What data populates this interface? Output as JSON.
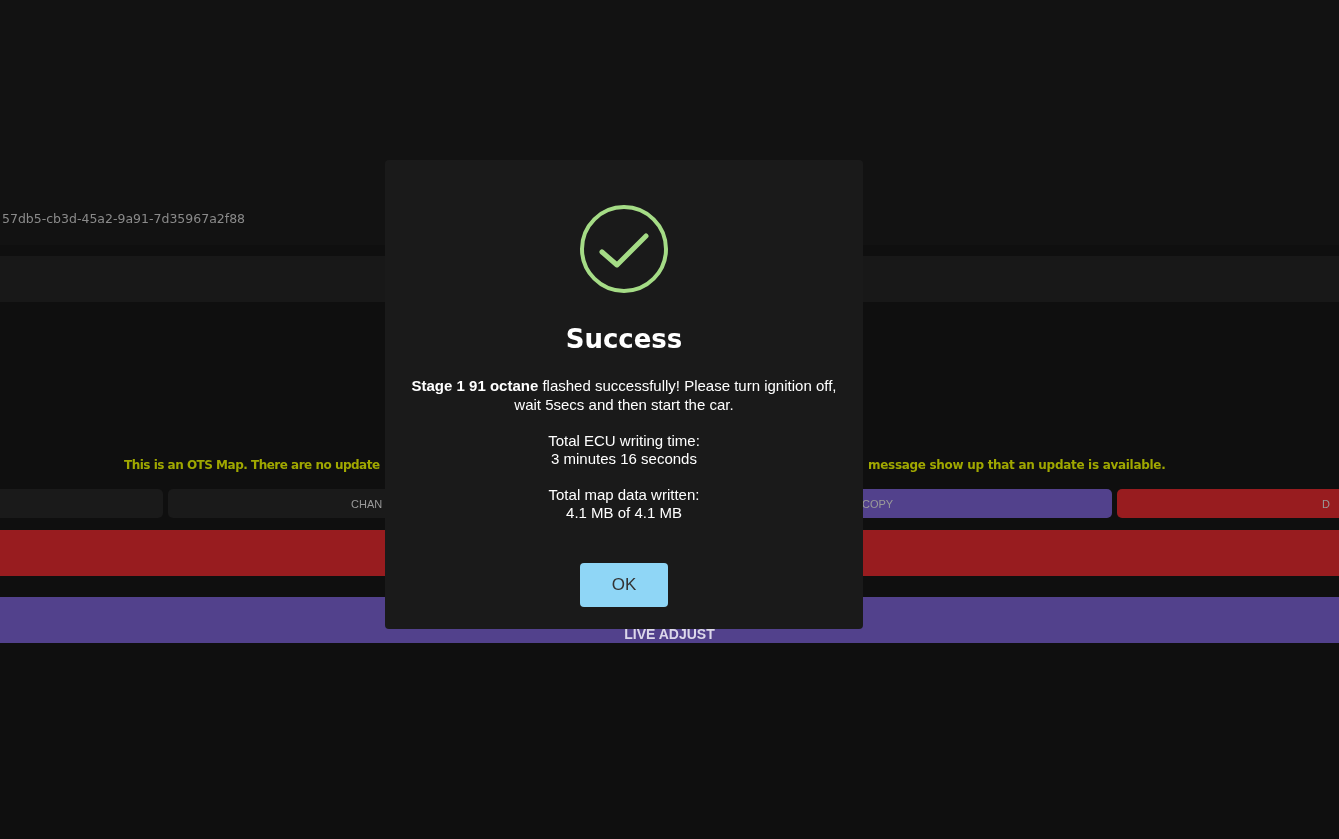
{
  "page": {
    "map_id": "57db5-cb3d-45a2-9a91-7d35967a2f88",
    "notice_parts": [
      "This is an OTS Map. There are no update",
      "message show up that an update is available."
    ],
    "action_buttons": [
      {
        "kind": "dark"
      },
      {
        "label": "CHAN",
        "kind": "dark"
      },
      {
        "label": "COPY",
        "kind": "purple"
      },
      {
        "label": "D",
        "kind": "red"
      }
    ],
    "wide_buttons": [
      {
        "kind": "red"
      },
      {
        "label": "LIVE ADJUST",
        "kind": "purple"
      }
    ]
  },
  "dialog": {
    "kind": "success",
    "title": "Success",
    "message": "**Stage 1 91 octane** flashed successfully! Please turn ignition off, wait 5secs and then start the car.",
    "stats": [
      {
        "label": "Total ECU writing time:",
        "value": "3 minutes 16 seconds"
      },
      {
        "label": "Total map data written:",
        "value": "4.1 MB of 4.1 MB"
      }
    ],
    "button": "OK"
  }
}
